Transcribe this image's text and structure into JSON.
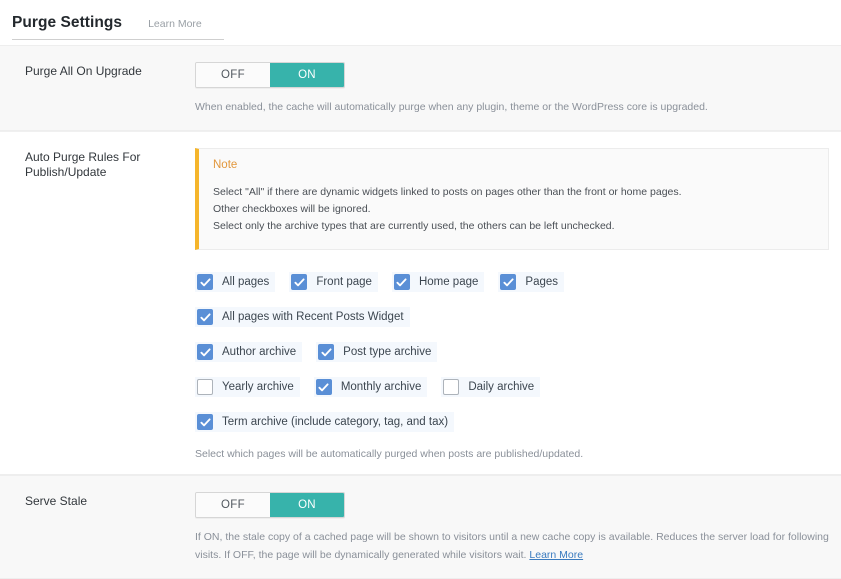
{
  "header": {
    "title": "Purge Settings",
    "learn_more": "Learn More"
  },
  "rows": {
    "purge_all_on_upgrade": {
      "label": "Purge All On Upgrade",
      "toggle": {
        "off": "OFF",
        "on": "ON",
        "state": "ON"
      },
      "description": "When enabled, the cache will automatically purge when any plugin, theme or the WordPress core is upgraded."
    },
    "auto_purge_rules": {
      "label": "Auto Purge Rules For Publish/Update",
      "note": {
        "title": "Note",
        "lines": [
          "Select \"All\" if there are dynamic widgets linked to posts on pages other than the front or home pages.",
          "Other checkboxes will be ignored.",
          "Select only the archive types that are currently used, the others can be left unchecked."
        ]
      },
      "checkbox_rows": [
        [
          {
            "label": "All pages",
            "checked": true
          },
          {
            "label": "Front page",
            "checked": true
          },
          {
            "label": "Home page",
            "checked": true
          },
          {
            "label": "Pages",
            "checked": true
          }
        ],
        [
          {
            "label": "All pages with Recent Posts Widget",
            "checked": true
          }
        ],
        [
          {
            "label": "Author archive",
            "checked": true
          },
          {
            "label": "Post type archive",
            "checked": true
          }
        ],
        [
          {
            "label": "Yearly archive",
            "checked": false
          },
          {
            "label": "Monthly archive",
            "checked": true
          },
          {
            "label": "Daily archive",
            "checked": false
          }
        ],
        [
          {
            "label": "Term archive (include category, tag, and tax)",
            "checked": true
          }
        ]
      ],
      "description": "Select which pages will be automatically purged when posts are published/updated."
    },
    "serve_stale": {
      "label": "Serve Stale",
      "toggle": {
        "off": "OFF",
        "on": "ON",
        "state": "ON"
      },
      "description_before_link": "If ON, the stale copy of a cached page will be shown to visitors until a new cache copy is available. Reduces the server load for following visits. If OFF, the page will be dynamically generated while visitors wait. ",
      "description_link": "Learn More"
    }
  },
  "colors": {
    "toggle_on": "#37b3ab",
    "checkbox_on": "#5a8fd6",
    "note_accent": "#f5b52b",
    "note_title": "#e2973c",
    "link": "#3a7bbf"
  }
}
